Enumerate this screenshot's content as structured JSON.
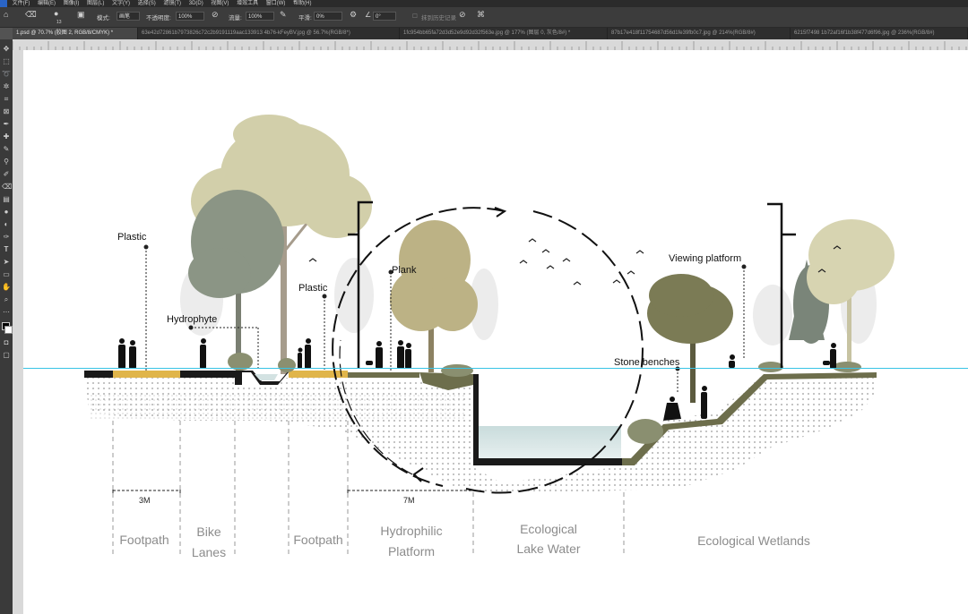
{
  "menu": {
    "items": [
      "文件(F)",
      "编辑(E)",
      "图像(I)",
      "图层(L)",
      "文字(Y)",
      "选择(S)",
      "滤镜(T)",
      "3D(D)",
      "视图(V)",
      "增效工具",
      "窗口(W)",
      "帮助(H)"
    ]
  },
  "options_bar": {
    "mode_label": "模式:",
    "mode_value": "画笔",
    "opacity_label": "不透明度:",
    "opacity_value": "100%",
    "flow_label": "流量:",
    "flow_value": "100%",
    "smooth_label": "平滑:",
    "smooth_value": "0%",
    "angle_value": "0°",
    "history_label": "抹到历史记录",
    "brush_size": "13"
  },
  "tabs": [
    {
      "label": "1.psd @ 70.7% (胶图 2, RGB/8/CMYK) *",
      "active": true
    },
    {
      "label": "63e42d72861b7973826c72c2b9191119aac133913 4b76-kFeyBV.jpg @ 56.7%(RGB/8*)",
      "active": false
    },
    {
      "label": "1fc954bb65fa72d3d52e9d92d32f563e.jpg @ 177% (图层 0, 灰色/8#) *",
      "active": false
    },
    {
      "label": "87b17e418f11754687d56d1fe39fb0c7.jpg @ 214%(RGB/8#)",
      "active": false
    },
    {
      "label": "6215f7498 1b72af16f1b38f477d6f96.jpg @ 236%(RGB/8#)",
      "active": false
    }
  ],
  "section": {
    "annotations": {
      "plastic_left": "Plastic",
      "hydrophyte": "Hydrophyte",
      "plastic_mid": "Plastic",
      "plank": "Plank",
      "viewing_platform": "Viewing platform",
      "stone_benches": "Stone benches"
    },
    "dimensions": {
      "dim_3m": "3M",
      "dim_7m": "7M"
    },
    "zones": {
      "footpath_1": "Footpath",
      "bike_1": "Bike",
      "bike_2": "Lanes",
      "footpath_2": "Footpath",
      "hydrophilic_1": "Hydrophilic",
      "hydrophilic_2": "Platform",
      "lake_1": "Ecological",
      "lake_2": "Lake Water",
      "wetlands": "Ecological  Wetlands"
    },
    "colors": {
      "ground": "#1a1a1a",
      "sand": "#e0b54a",
      "grass": "#6d6e4c",
      "water": "#d3e2e2",
      "guide": "#37c3e6"
    }
  }
}
